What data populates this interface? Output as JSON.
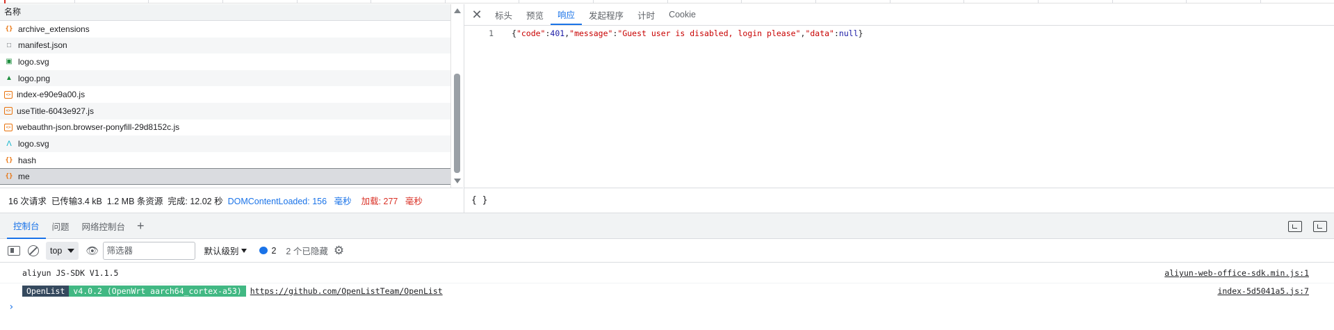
{
  "network": {
    "column_name": "名称",
    "rows": [
      {
        "name": "archive_extensions",
        "icon": "xhr-icon"
      },
      {
        "name": "manifest.json",
        "icon": "document-icon"
      },
      {
        "name": "logo.svg",
        "icon": "image-icon"
      },
      {
        "name": "logo.png",
        "icon": "image-icon"
      },
      {
        "name": "index-e90e9a00.js",
        "icon": "script-icon"
      },
      {
        "name": "useTitle-6043e927.js",
        "icon": "script-icon"
      },
      {
        "name": "webauthn-json.browser-ponyfill-29d8152c.js",
        "icon": "script-icon"
      },
      {
        "name": "logo.svg",
        "icon": "svg-icon"
      },
      {
        "name": "hash",
        "icon": "xhr-icon"
      },
      {
        "name": "me",
        "icon": "xhr-icon",
        "selected": true
      }
    ]
  },
  "details": {
    "tabs": [
      "标头",
      "预览",
      "响应",
      "发起程序",
      "计时",
      "Cookie"
    ],
    "active_tab": "响应",
    "response": {
      "line_number": "1",
      "p1": "{",
      "k_code": "\"code\"",
      "c1": ":",
      "v_code": "401",
      "p2": ",",
      "k_message": "\"message\"",
      "c2": ":",
      "v_message": "\"Guest user is disabled, login please\"",
      "p3": ",",
      "k_data": "\"data\"",
      "c3": ":",
      "v_data": "null",
      "p4": "}"
    },
    "format_button": "{ }"
  },
  "status": {
    "requests": "16 次请求",
    "transferred": "已传输3.4 kB",
    "resources": "1.2 MB 条资源",
    "finish": "完成: 12.02 秒",
    "dcl_label": "DOMContentLoaded: 156",
    "dcl_unit": "毫秒",
    "load_label": "加载: 277",
    "load_unit": "毫秒"
  },
  "drawer": {
    "tabs": [
      "控制台",
      "问题",
      "网络控制台"
    ],
    "active_tab": "控制台",
    "add_tab": "+"
  },
  "console_toolbar": {
    "context": "top",
    "filter_placeholder": "筛选器",
    "level": "默认级别",
    "issues_count": "2",
    "hidden": "2 个已隐藏"
  },
  "console_messages": [
    {
      "text": "aliyun JS-SDK V1.1.5",
      "source": "aliyun-web-office-sdk.min.js:1"
    },
    {
      "badge1": "OpenList",
      "badge2": "v4.0.2 (OpenWrt aarch64_cortex-a53)",
      "link": "https://github.com/OpenListTeam/OpenList",
      "source": "index-5d5041a5.js:7"
    }
  ],
  "colors": {
    "accent": "#1a73e8",
    "selected_row": "#dadce0",
    "badge_dark": "#35495e",
    "badge_green": "#41b883",
    "error_red": "#d93025"
  }
}
